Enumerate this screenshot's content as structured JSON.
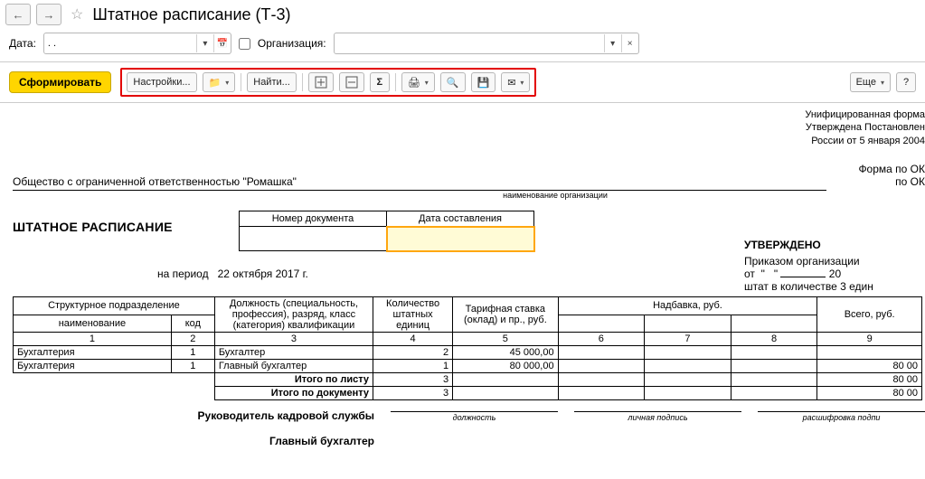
{
  "titlebar": {
    "title": "Штатное расписание (Т-3)"
  },
  "filter": {
    "date_label": "Дата:",
    "date_value": ". .",
    "org_label": "Организация:",
    "org_value": ""
  },
  "toolbar": {
    "form": "Сформировать",
    "settings": "Настройки...",
    "find": "Найти...",
    "more": "Еще",
    "help": "?"
  },
  "stamp": {
    "l1": "Унифицированная форма",
    "l2": "Утверждена Постановлен",
    "l3": "России от 5 января 2004",
    "okud": "Форма по ОК",
    "okpo": "по ОК"
  },
  "org": {
    "name": "Общество с ограниченной ответственностью \"Ромашка\"",
    "caption": "наименование организации"
  },
  "doc": {
    "title": "ШТАТНОЕ РАСПИСАНИЕ",
    "num_hdr": "Номер документа",
    "date_hdr": "Дата составления",
    "num_val": "",
    "date_val": "",
    "period_label": "на период",
    "period_val": "22 октября 2017 г."
  },
  "approved": {
    "hd": "УТВЕРЖДЕНО",
    "l1": "Приказом организации",
    "from": "от",
    "year": "20",
    "staff": "штат в количестве 3 един"
  },
  "table": {
    "hdr": {
      "subdiv": "Структурное  подразделение",
      "name": "наименование",
      "code": "код",
      "position": "Должность (специальность, профессия), разряд, класс (категория) квалификации",
      "units": "Количество штатных единиц",
      "rate": "Тарифная ставка (оклад) и пр., руб.",
      "allowance": "Надбавка, руб.",
      "total": "Всего, руб."
    },
    "nums": [
      "1",
      "2",
      "3",
      "4",
      "5",
      "6",
      "7",
      "8",
      "9"
    ],
    "rows": [
      {
        "subdiv": "Бухгалтерия",
        "code": "1",
        "pos": "Бухгалтер",
        "units": "2",
        "rate": "45 000,00",
        "a1": "",
        "a2": "",
        "a3": "",
        "total": ""
      },
      {
        "subdiv": "Бухгалтерия",
        "code": "1",
        "pos": "Главный бухгалтер",
        "units": "1",
        "rate": "80 000,00",
        "a1": "",
        "a2": "",
        "a3": "",
        "total": "80 00"
      }
    ],
    "itogo_sheet": "Итого по листу",
    "itogo_doc": "Итого по документу",
    "itogo_units": "3",
    "itogo_total": "80 00"
  },
  "sign": {
    "hr": "Руководитель кадровой службы",
    "acc": "Главный бухгалтер",
    "pos": "должность",
    "sig": "личная подпись",
    "name": "расшифровка  подпи"
  }
}
